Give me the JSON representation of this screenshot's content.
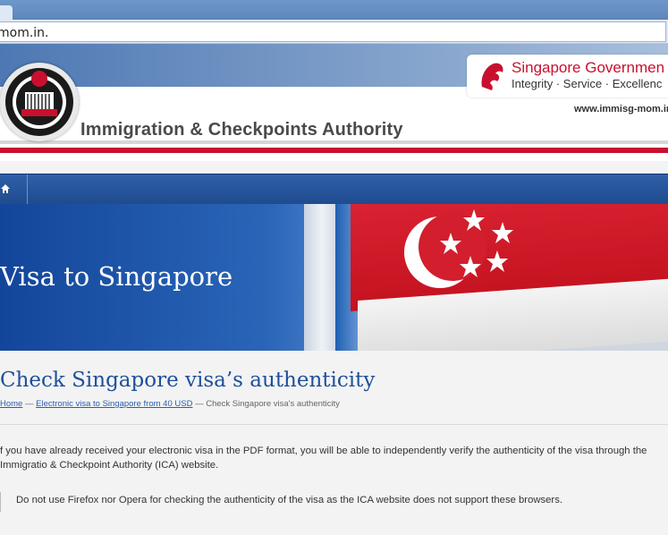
{
  "browser": {
    "url": "mom.in."
  },
  "header": {
    "agency_name": "Immigration & Checkpoints Authority",
    "gov_title": "Singapore Governmen",
    "gov_motto": "Integrity · Service · Excellenc",
    "site_url": "www.immisg-mom.in",
    "emblem_icon": "ica-emblem",
    "lion_icon": "singapore-lion-icon",
    "accent_red": "#c8102e",
    "brand_blue": "#1e4f9a"
  },
  "nav": {
    "home_icon": "home-icon"
  },
  "hero": {
    "title": "Visa to Singapore"
  },
  "main": {
    "title": "Check Singapore visa’s authenticity",
    "breadcrumb": {
      "home": "Home",
      "sep1": " — ",
      "parent": "Electronic visa to Singapore from 40 USD",
      "sep2": " — ",
      "current": "Check Singapore visa's authenticity"
    },
    "paragraph": "f you have already received your electronic visa in the PDF format, you will be able to independently verify the authenticity of the visa through the Immigratio & Checkpoint Authority (ICA) website.",
    "notice": "Do not use Firefox nor Opera for checking the authenticity of the visa as the ICA website does not support these browsers."
  }
}
